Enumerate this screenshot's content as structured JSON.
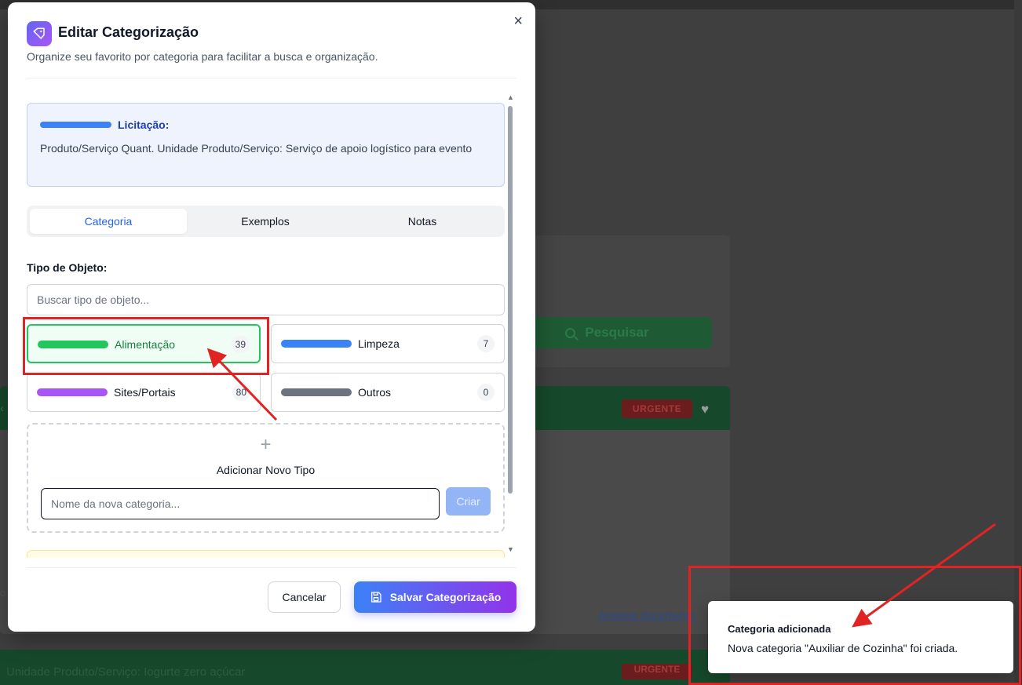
{
  "background": {
    "search_button_label": "Pesquisar",
    "badge_label": "URGENTE",
    "link_text": "Acessar documento",
    "card2_text": "Unidade Produto/Serviço: Iogurte zero açúcar",
    "badge2_label": "URGENTE"
  },
  "modal": {
    "title": "Editar Categorização",
    "subtitle": "Organize seu favorito por categoria para facilitar a busca e organização.",
    "close_glyph": "×",
    "info": {
      "label": "Licitação:",
      "text": "Produto/Serviço Quant. Unidade Produto/Serviço: Serviço de apoio logístico para evento",
      "accent": "#3b82f6"
    },
    "tabs": [
      {
        "label": "Categoria",
        "active": true
      },
      {
        "label": "Exemplos",
        "active": false
      },
      {
        "label": "Notas",
        "active": false
      }
    ],
    "type_section_label": "Tipo de Objeto:",
    "type_search_placeholder": "Buscar tipo de objeto...",
    "types": [
      {
        "label": "Alimentação",
        "count": "39",
        "color": "#22c55e",
        "selected": true
      },
      {
        "label": "Limpeza",
        "count": "7",
        "color": "#3b82f6",
        "selected": false
      },
      {
        "label": "Sites/Portais",
        "count": "80",
        "color": "#a855f7",
        "selected": false
      },
      {
        "label": "Outros",
        "count": "0",
        "color": "#6b7280",
        "selected": false
      }
    ],
    "add_new": {
      "plus_glyph": "+",
      "title": "Adicionar Novo Tipo",
      "placeholder": "Nome da nova categoria...",
      "create_label": "Criar"
    },
    "footer": {
      "cancel_label": "Cancelar",
      "save_label": "Salvar Categorização"
    }
  },
  "toast": {
    "title": "Categoria adicionada",
    "message": "Nova categoria \"Auxiliar de Cozinha\" foi criada."
  },
  "annotation_color": "#e02424"
}
